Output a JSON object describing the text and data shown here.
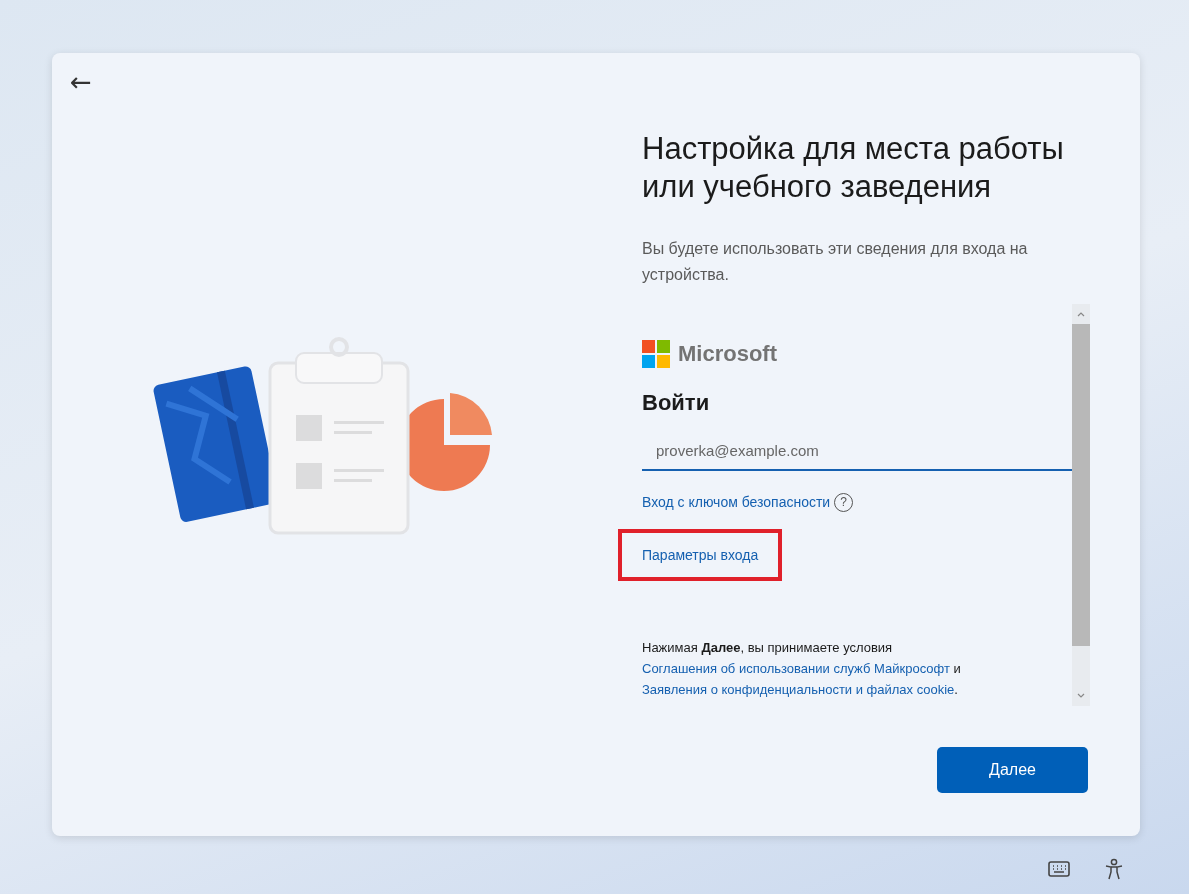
{
  "back_button": {
    "label": "←"
  },
  "heading": "Настройка для места работы или учебного заведения",
  "subtitle": "Вы будете использовать эти сведения для входа на устройства.",
  "signin": {
    "brand": "Microsoft",
    "title": "Войти",
    "email": {
      "placeholder": "proverka@example.com"
    },
    "links": [
      {
        "label": "Вход с ключом безопасности",
        "help": "?",
        "highlighted": false
      },
      {
        "label": "Параметры входа",
        "highlighted": true
      }
    ],
    "legal": [
      {
        "kind": "text",
        "text": "Нажимая "
      },
      {
        "kind": "bold",
        "text": "Далее"
      },
      {
        "kind": "text",
        "text": ", вы принимаете условия "
      },
      {
        "kind": "link",
        "text": "Соглашения об использовании служб Майкрософт"
      },
      {
        "kind": "text",
        "text": " и "
      },
      {
        "kind": "link",
        "text": "Заявления о конфиденциальности и файлах cookie"
      },
      {
        "kind": "text",
        "text": "."
      }
    ]
  },
  "next_button": {
    "label": "Далее"
  }
}
